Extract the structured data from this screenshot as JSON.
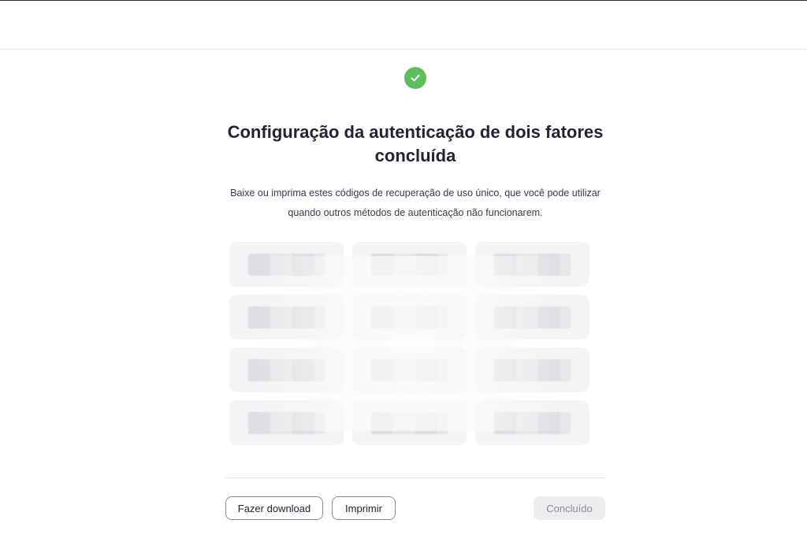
{
  "header": {
    "success_icon": "check-circle-icon",
    "title": "Configuração da autenticação de dois fatores concluída",
    "description": "Baixe ou imprima estes códigos de recuperação de uso único, que você pode utilizar quando outros métodos de autenticação não funcionarem."
  },
  "recovery_codes": {
    "items": [
      "",
      "",
      "",
      "",
      "",
      "",
      "",
      "",
      "",
      "",
      "",
      ""
    ]
  },
  "actions": {
    "download_label": "Fazer download",
    "print_label": "Imprimir",
    "done_label": "Concluído"
  },
  "colors": {
    "success": "#5cbf5c",
    "text_primary": "#232333",
    "card_bg": "#f4f4f6",
    "disabled_bg": "#ededf0",
    "disabled_text": "#8c8c96"
  }
}
